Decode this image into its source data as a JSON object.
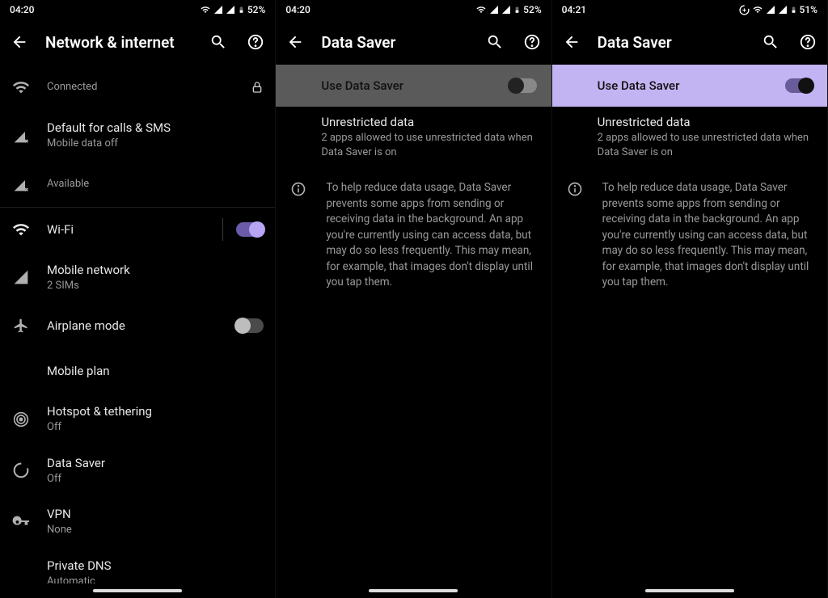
{
  "panels": [
    {
      "status": {
        "time": "04:20",
        "battery": "52%"
      },
      "title": "Network & internet",
      "items": [
        {
          "icon": "wifi",
          "primary": "",
          "secondary": "Connected",
          "trailing": "lock"
        },
        {
          "icon": "signal-x",
          "primary": "Default for calls & SMS",
          "secondary": "Mobile data off"
        },
        {
          "icon": "signal-x",
          "primary": "",
          "secondary": "Available"
        },
        {
          "icon": "wifi",
          "primary": "Wi-Fi",
          "secondary": "",
          "trailing": "toggle-on",
          "divider": true
        },
        {
          "icon": "signal",
          "primary": "Mobile network",
          "secondary": "2 SIMs"
        },
        {
          "icon": "airplane",
          "primary": "Airplane mode",
          "secondary": "",
          "trailing": "toggle-off"
        },
        {
          "icon": "",
          "primary": "Mobile plan",
          "secondary": ""
        },
        {
          "icon": "hotspot",
          "primary": "Hotspot & tethering",
          "secondary": "Off"
        },
        {
          "icon": "datasaver",
          "primary": "Data Saver",
          "secondary": "Off"
        },
        {
          "icon": "vpn",
          "primary": "VPN",
          "secondary": "None"
        },
        {
          "icon": "",
          "primary": "Private DNS",
          "secondary": "Automatic"
        }
      ]
    },
    {
      "status": {
        "time": "04:20",
        "battery": "52%"
      },
      "title": "Data Saver",
      "master": {
        "label": "Use Data Saver",
        "state": "off",
        "style": "grey"
      },
      "unrestricted": {
        "title": "Unrestricted data",
        "subtitle": "2 apps allowed to use unrestricted data when Data Saver is on"
      },
      "info": "To help reduce data usage, Data Saver prevents some apps from sending or receiving data in the background. An app you're currently using can access data, but may do so less frequently. This may mean, for example, that images don't display until you tap them."
    },
    {
      "status": {
        "time": "04:21",
        "battery": "51%",
        "extraIcon": true
      },
      "title": "Data Saver",
      "master": {
        "label": "Use Data Saver",
        "state": "on",
        "style": "lilac"
      },
      "unrestricted": {
        "title": "Unrestricted data",
        "subtitle": "2 apps allowed to use unrestricted data when Data Saver is on"
      },
      "info": "To help reduce data usage, Data Saver prevents some apps from sending or receiving data in the background. An app you're currently using can access data, but may do so less frequently. This may mean, for example, that images don't display until you tap them."
    }
  ]
}
